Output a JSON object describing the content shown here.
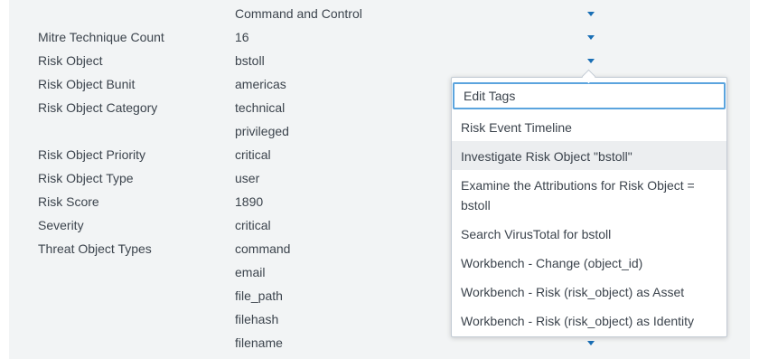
{
  "fields": [
    {
      "key": "",
      "value": "Command and Control",
      "caret": true
    },
    {
      "key": "Mitre Technique Count",
      "value": "16",
      "caret": true
    },
    {
      "key": "Risk Object",
      "value": "bstoll",
      "caret": true
    },
    {
      "key": "Risk Object Bunit",
      "value": "americas",
      "caret": false
    },
    {
      "key": "Risk Object Category",
      "value": "technical",
      "caret": false
    },
    {
      "key": "",
      "value": "privileged",
      "caret": false
    },
    {
      "key": "Risk Object Priority",
      "value": "critical",
      "caret": false
    },
    {
      "key": "Risk Object Type",
      "value": "user",
      "caret": false
    },
    {
      "key": "Risk Score",
      "value": "1890",
      "caret": false
    },
    {
      "key": "Severity",
      "value": "critical",
      "caret": false
    },
    {
      "key": "Threat Object Types",
      "value": "command",
      "caret": false
    },
    {
      "key": "",
      "value": "email",
      "caret": false
    },
    {
      "key": "",
      "value": "file_path",
      "caret": false
    },
    {
      "key": "",
      "value": "filehash",
      "caret": false
    },
    {
      "key": "",
      "value": "filename",
      "caret": true
    }
  ],
  "menu": {
    "items": [
      "Edit Tags",
      "Risk Event Timeline",
      "Investigate Risk Object \"bstoll\"",
      "Examine the Attributions for Risk Object = bstoll",
      "Search VirusTotal for bstoll",
      "Workbench - Change (object_id)",
      "Workbench - Risk (risk_object) as Asset",
      "Workbench - Risk (risk_object) as Identity"
    ]
  },
  "colors": {
    "panel_bg": "#f2f4f5",
    "caret": "#1a6fb5",
    "focus_ring": "#5ba4de",
    "hover_bg": "#eceef0"
  }
}
